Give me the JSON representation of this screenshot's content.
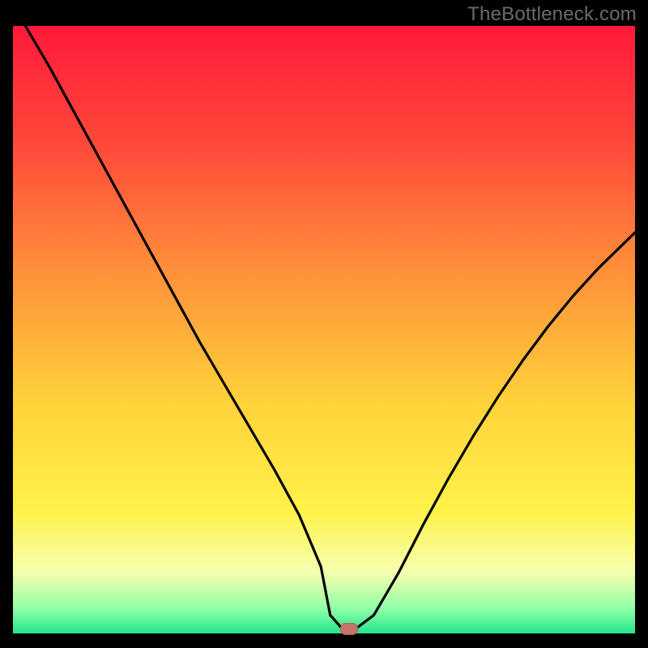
{
  "branding": {
    "watermark": "TheBottleneck.com"
  },
  "chart_data": {
    "type": "line",
    "title": "",
    "xlabel": "",
    "ylabel": "",
    "xlim": [
      0,
      100
    ],
    "ylim": [
      0,
      100
    ],
    "grid": false,
    "legend": false,
    "background": {
      "type": "vertical-gradient",
      "stops": [
        {
          "offset": 0.0,
          "color": "#ff1a3a"
        },
        {
          "offset": 0.2,
          "color": "#ff4a3a"
        },
        {
          "offset": 0.4,
          "color": "#ff8f3a"
        },
        {
          "offset": 0.62,
          "color": "#ffd23a"
        },
        {
          "offset": 0.8,
          "color": "#fff24a"
        },
        {
          "offset": 0.9,
          "color": "#f6ffb0"
        },
        {
          "offset": 0.96,
          "color": "#8effa6"
        },
        {
          "offset": 1.0,
          "color": "#22e58c"
        }
      ]
    },
    "series": [
      {
        "name": "bottleneck-curve",
        "x": [
          2,
          6,
          10,
          14,
          18,
          22,
          26,
          30,
          34,
          38,
          42,
          46,
          49.5,
          51,
          53,
          55,
          58,
          62,
          66,
          70,
          74,
          78,
          82,
          86,
          90,
          94,
          98,
          100
        ],
        "y": [
          100,
          93,
          85.5,
          78,
          70.5,
          63,
          55.5,
          48,
          41,
          34,
          27,
          19.5,
          11,
          3,
          0.7,
          0.7,
          3,
          10,
          18,
          25.5,
          32.5,
          39,
          45,
          50.5,
          55.5,
          60,
          64,
          66
        ],
        "color": "#000000",
        "width": 3.2
      }
    ],
    "annotations": [
      {
        "name": "optimal-marker",
        "x": 54,
        "y": 0.8,
        "color": "#c9736b",
        "shape": "rounded-rect"
      }
    ]
  }
}
